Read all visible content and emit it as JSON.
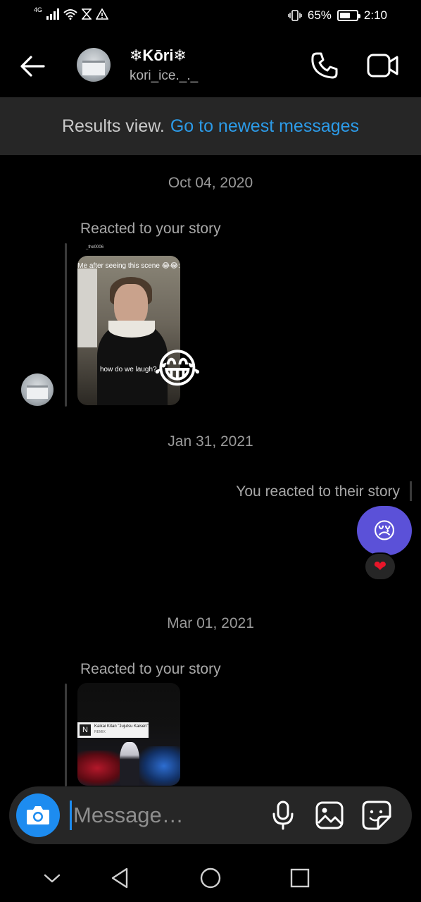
{
  "status_bar": {
    "network": "4G",
    "battery_percent": "65%",
    "battery_level": 0.65,
    "time": "2:10"
  },
  "header": {
    "contact_name": "❄Kōri❄",
    "username": "kori_ice._._"
  },
  "results_bar": {
    "text": "Results view.",
    "link": "Go to newest messages"
  },
  "conversation": {
    "date_1": "Oct 04, 2020",
    "reacted_label_1": "Reacted to your story",
    "story_1": {
      "top_caption": "Me after seeing this scene 😂😂:",
      "bottom_caption": "how do we laugh?",
      "reaction_emoji": "😂",
      "poster_handle": "_the0006"
    },
    "date_2": "Jan 31, 2021",
    "my_reacted_label": "You reacted to their story",
    "my_reaction_emoji": "😢",
    "heart_reaction": "❤",
    "date_3": "Mar 01, 2021",
    "reacted_label_2": "Reacted to your story",
    "story_2": {
      "card_title": "Kaikai Kitan \"Jujutsu Kaisen\"",
      "card_sub": "REMIX",
      "card_logo": "N"
    }
  },
  "composer": {
    "placeholder": "Message…"
  },
  "icons": {
    "back": "arrow-left-icon",
    "call": "phone-icon",
    "video": "video-camera-icon",
    "camera": "camera-icon",
    "mic": "microphone-icon",
    "gallery": "image-icon",
    "sticker": "sticker-icon",
    "nav_down": "chevron-down-icon",
    "nav_back": "triangle-back-icon",
    "nav_home": "circle-home-icon",
    "nav_recent": "square-recent-icon"
  },
  "colors": {
    "accent": "#1d8cf0",
    "link": "#2c9be8",
    "sent_bubble": "#5b51d8",
    "background": "#000000",
    "bar": "#262626"
  }
}
